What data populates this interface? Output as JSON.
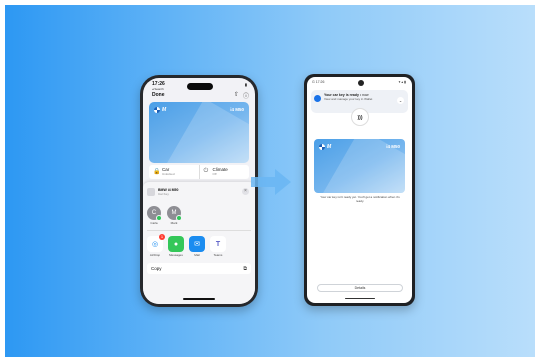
{
  "colors": {
    "accent": "#2d98f3",
    "wallet_blue": "#1a73e8",
    "bmw_blue": "#1d5fb5",
    "green": "#2fc65a",
    "red": "#ff3b30"
  },
  "iphone": {
    "status_time": "17:26",
    "status_sub": "◂ Search",
    "battery": "▮",
    "done": "Done",
    "key_card": {
      "brand_mark": "M",
      "model": "i4 M50"
    },
    "car_row": [
      {
        "label": "Car",
        "sub": "Unlocked",
        "icon": "car-icon"
      },
      {
        "label": "Climate",
        "sub": "Off",
        "icon": "power-icon"
      }
    ],
    "share_sheet": {
      "title": "BMW i4 M50",
      "subtitle": "Car Key",
      "close": "×",
      "people": [
        {
          "initial": "C",
          "name": "Carla"
        },
        {
          "initial": "M",
          "name": "Mark"
        }
      ],
      "apps": [
        {
          "name": "AirDrop",
          "icon": "airdrop-icon",
          "badge": "1"
        },
        {
          "name": "Messages",
          "icon": "messages-icon"
        },
        {
          "name": "Mail",
          "icon": "mail-icon"
        },
        {
          "name": "Teams",
          "icon": "teams-icon"
        }
      ],
      "copy": "Copy"
    }
  },
  "android": {
    "status_left": "G 17:26",
    "status_right": "▾ ▴ ▮",
    "notification": {
      "title": "Your car key is ready",
      "time": "• now",
      "body": "View and manage your key in Wallet"
    },
    "nfc": ")))",
    "key_card": {
      "brand_mark": "M",
      "model": "i4 M50"
    },
    "message": "Your car key isn't ready yet. You'll get a notification when it's ready.",
    "details": "Details"
  }
}
